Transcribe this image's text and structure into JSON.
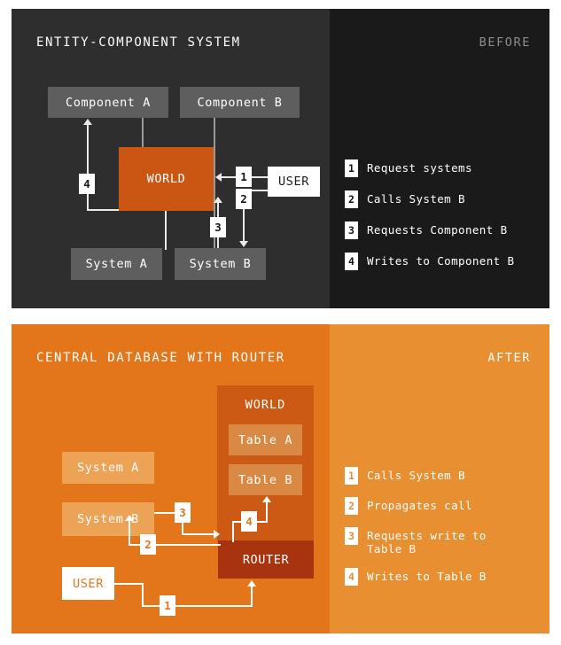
{
  "panels": [
    {
      "id": "before",
      "stage_title": "ENTITY-COMPONENT SYSTEM",
      "side_title": "BEFORE",
      "nodes": {
        "component_a": "Component A",
        "component_b": "Component B",
        "world": "WORLD",
        "user": "USER",
        "system_a": "System A",
        "system_b": "System B"
      },
      "markers": {
        "m1": "1",
        "m2": "2",
        "m3": "3",
        "m4": "4"
      },
      "legend": [
        {
          "n": "1",
          "text": "Request systems"
        },
        {
          "n": "2",
          "text": "Calls System B"
        },
        {
          "n": "3",
          "text": "Requests Component B"
        },
        {
          "n": "4",
          "text": "Writes to Component B"
        }
      ],
      "colors": {
        "stage_bg": "#2e2e2e",
        "legend_bg": "#1a1a1a",
        "node_bg": "#5e5e5e",
        "accent": "#cb5513",
        "line": "#9a9a9a"
      }
    },
    {
      "id": "after",
      "stage_title": "CENTRAL DATABASE WITH ROUTER",
      "side_title": "AFTER",
      "nodes": {
        "system_a": "System A",
        "system_b": "System B",
        "user": "USER",
        "world": "WORLD",
        "table_a": "Table A",
        "table_b": "Table B",
        "router": "ROUTER"
      },
      "markers": {
        "m1": "1",
        "m2": "2",
        "m3": "3",
        "m4": "4"
      },
      "legend": [
        {
          "n": "1",
          "text": "Calls System B"
        },
        {
          "n": "2",
          "text": "Propagates call"
        },
        {
          "n": "3",
          "text": "Requests write to\nTable B"
        },
        {
          "n": "4",
          "text": "Writes to Table B"
        }
      ],
      "colors": {
        "stage_bg": "#e3761a",
        "legend_bg": "#e88f31",
        "node_bg": "#eda355",
        "world_bg": "#cc5a14",
        "table_bg": "#d98944",
        "router_bg": "#a8330f",
        "line": "#ffffff"
      }
    }
  ]
}
